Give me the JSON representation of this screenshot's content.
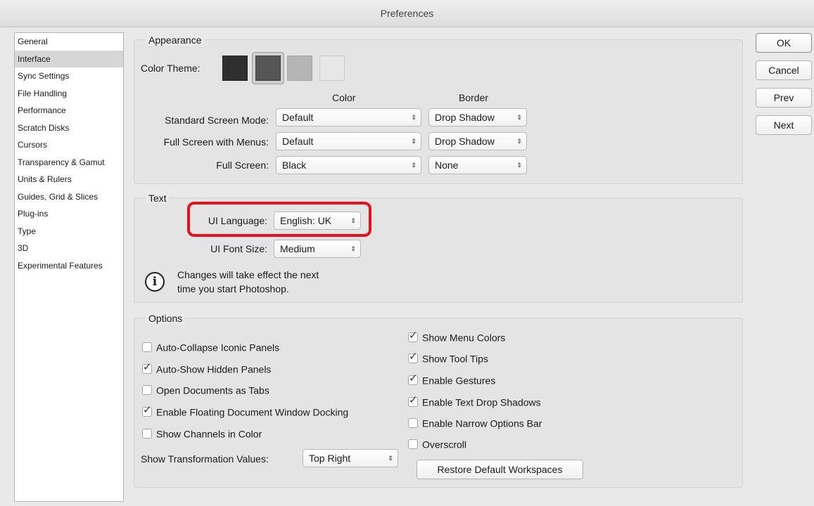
{
  "window": {
    "title": "Preferences"
  },
  "sidebar": {
    "items": [
      {
        "label": "General"
      },
      {
        "label": "Interface"
      },
      {
        "label": "Sync Settings"
      },
      {
        "label": "File Handling"
      },
      {
        "label": "Performance"
      },
      {
        "label": "Scratch Disks"
      },
      {
        "label": "Cursors"
      },
      {
        "label": "Transparency & Gamut"
      },
      {
        "label": "Units & Rulers"
      },
      {
        "label": "Guides, Grid & Slices"
      },
      {
        "label": "Plug-ins"
      },
      {
        "label": "Type"
      },
      {
        "label": "3D"
      },
      {
        "label": "Experimental Features"
      }
    ],
    "selected": "Interface"
  },
  "appearance": {
    "title": "Appearance",
    "color_theme_label": "Color Theme:",
    "themes": [
      "#2f2f2f",
      "#555555",
      "#b4b4b4",
      "#e6e6e6"
    ],
    "selected_theme_index": 1,
    "col_color": "Color",
    "col_border": "Border",
    "rows": [
      {
        "label": "Standard Screen Mode:",
        "color": "Default",
        "border": "Drop Shadow"
      },
      {
        "label": "Full Screen with Menus:",
        "color": "Default",
        "border": "Drop Shadow"
      },
      {
        "label": "Full Screen:",
        "color": "Black",
        "border": "None"
      }
    ]
  },
  "text": {
    "title": "Text",
    "ui_language_label": "UI Language:",
    "ui_language_value": "English: UK",
    "ui_font_size_label": "UI Font Size:",
    "ui_font_size_value": "Medium",
    "info_line1": "Changes will take effect the next",
    "info_line2": "time you start Photoshop.",
    "highlight_color": "#e3111b"
  },
  "options": {
    "title": "Options",
    "left": [
      {
        "label": "Auto-Collapse Iconic Panels",
        "checked": false
      },
      {
        "label": "Auto-Show Hidden Panels",
        "checked": true
      },
      {
        "label": "Open Documents as Tabs",
        "checked": false
      },
      {
        "label": "Enable Floating Document Window Docking",
        "checked": true
      },
      {
        "label": "Show Channels in Color",
        "checked": false
      }
    ],
    "right": [
      {
        "label": "Show Menu Colors",
        "checked": true
      },
      {
        "label": "Show Tool Tips",
        "checked": true
      },
      {
        "label": "Enable Gestures",
        "checked": true
      },
      {
        "label": "Enable Text Drop Shadows",
        "checked": true
      },
      {
        "label": "Enable Narrow Options Bar",
        "checked": false
      },
      {
        "label": "Overscroll",
        "checked": false
      }
    ],
    "transform_label": "Show Transformation Values:",
    "transform_value": "Top Right",
    "restore_button": "Restore Default Workspaces"
  },
  "buttons": {
    "ok": "OK",
    "cancel": "Cancel",
    "prev": "Prev",
    "next": "Next"
  }
}
